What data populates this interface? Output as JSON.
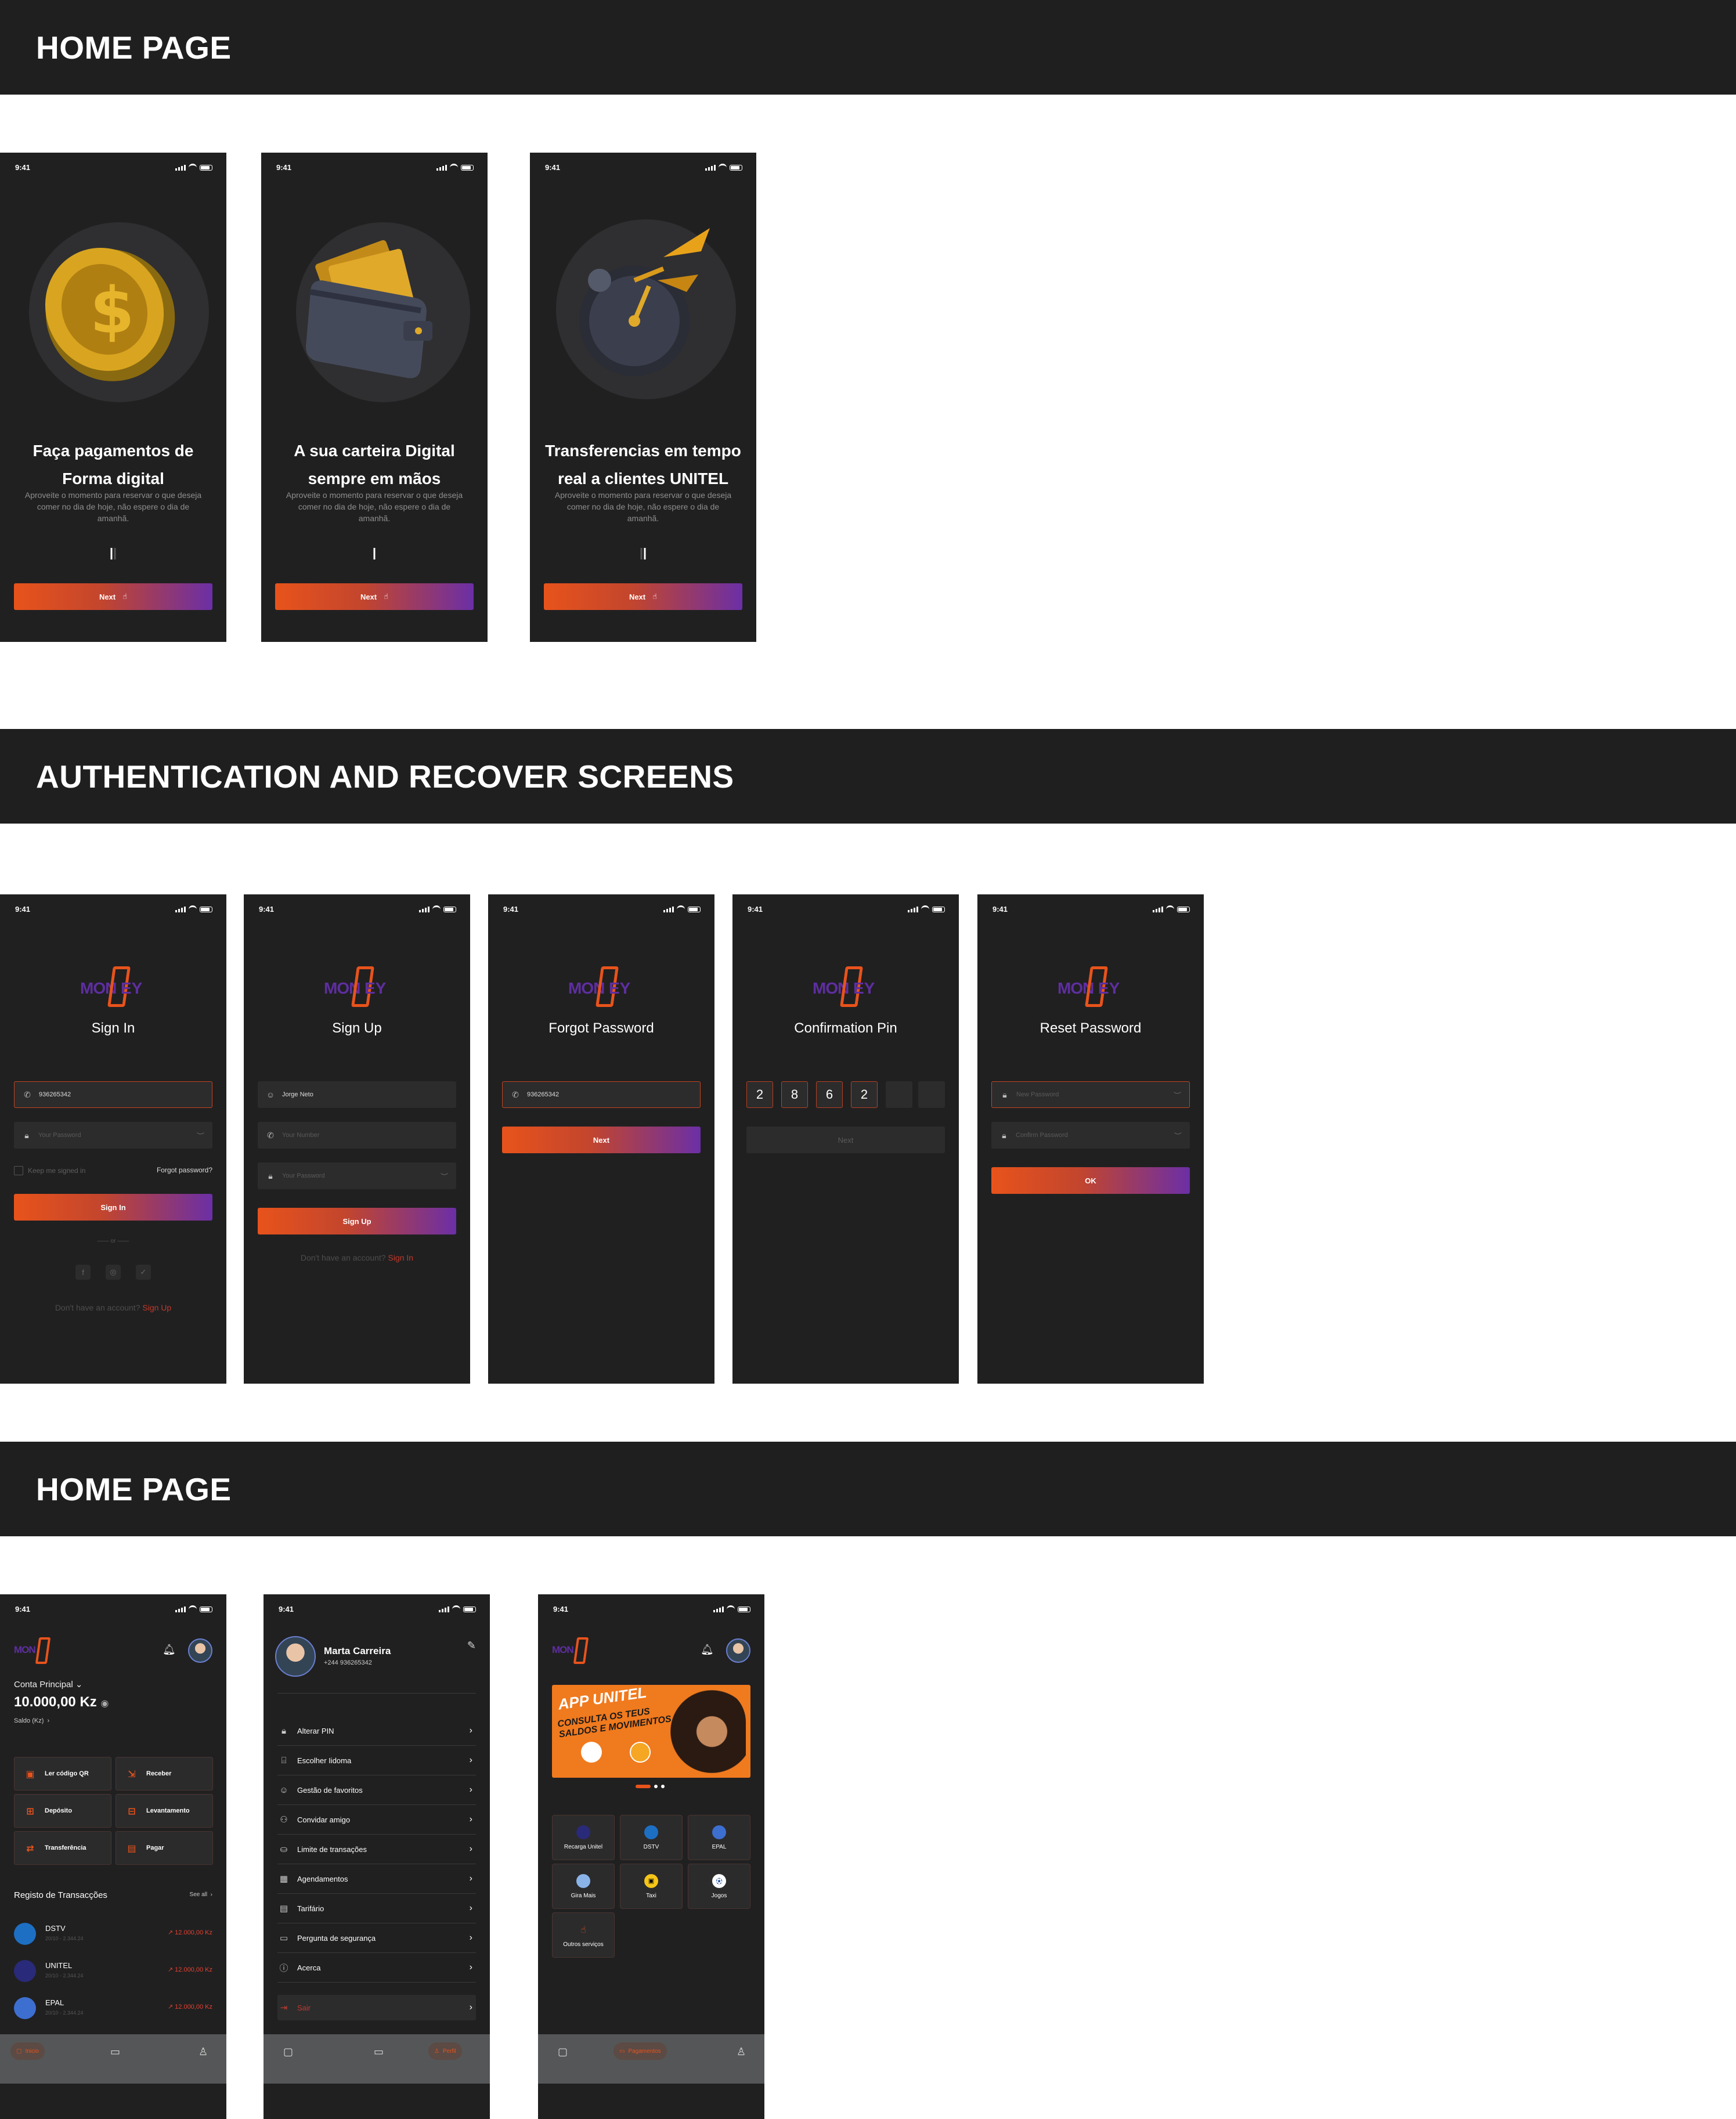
{
  "status": {
    "time": "9:41"
  },
  "sections": {
    "home1": "HOME PAGE",
    "auth": "AUTHENTICATION AND RECOVER SCREENS",
    "home2": "HOME PAGE"
  },
  "onboarding": [
    {
      "title_line1": "Faça pagamentos de",
      "title_line2": "Forma digital",
      "desc": "Aproveite o momento para reservar o que deseja comer no dia de hoje, não espere o dia de amanhã.",
      "button": "Next"
    },
    {
      "title_line1": "A sua carteira Digital",
      "title_line2": "sempre em mãos",
      "desc": "Aproveite o momento para reservar o que deseja comer no dia de hoje, não espere o dia de amanhã.",
      "button": "Next"
    },
    {
      "title_line1": "Transferencias em tempo",
      "title_line2": "real  a clientes UNITEL",
      "desc": "Aproveite o momento para reservar o que deseja comer no dia de hoje, não espere o dia de amanhã.",
      "button": "Next"
    }
  ],
  "logo": {
    "left": "MON",
    "right": "EY"
  },
  "signin": {
    "title": "Sign In",
    "phone_value": "936265342",
    "password_placeholder": "Your Password",
    "keep_signed": "Keep me signed in",
    "forgot": "Forgot password?",
    "button": "Sign In",
    "or": "or",
    "no_account": "Don't have an account?",
    "signup_link": "Sign Up"
  },
  "signup": {
    "title": "Sign Up",
    "name_value": "Jorge Neto",
    "number_placeholder": "Your Number",
    "password_placeholder": "Your Password",
    "button": "Sign Up",
    "have_account": "Don't have an account?",
    "signin_link": "Sign In"
  },
  "forgot": {
    "title": "Forgot Password",
    "phone_value": "936265342",
    "button": "Next"
  },
  "pin": {
    "title": "Confirmation Pin",
    "digits": [
      "2",
      "8",
      "6",
      "2",
      "",
      ""
    ],
    "button": "Next"
  },
  "reset": {
    "title": "Reset Password",
    "new_placeholder": "New Password",
    "confirm_placeholder": "Confirm Password",
    "button": "OK"
  },
  "dashboard": {
    "account_label": "Conta Principal",
    "balance": "10.000,00 Kz",
    "saldo": "Saldo (Kz)",
    "actions": [
      "Ler código QR",
      "Receber",
      "Depósito",
      "Levantamento",
      "Transferência",
      "Pagar"
    ],
    "tx_title": "Registo de Transacções",
    "see_all": "See all",
    "transactions": [
      {
        "name": "DSTV",
        "date": "20/10 - 2.344.24",
        "amount": "12.000,00 Kz",
        "color": "#1d6fc4"
      },
      {
        "name": "UNITEL",
        "date": "20/10 - 2.344.24",
        "amount": "12.000,00 Kz",
        "color": "#2a2a7a"
      },
      {
        "name": "EPAL",
        "date": "20/10 - 2.344.24",
        "amount": "12.000,00 Kz",
        "color": "#3d6fd0"
      }
    ],
    "nav": {
      "home": "Inicio"
    }
  },
  "profile": {
    "name": "Marta Carreira",
    "phone": "+244 936265342",
    "items": [
      "Alterar PIN",
      "Escolher Iidoma",
      "Gestão de favoritos",
      "Convidar amigo",
      "Limite de transações",
      "Agendamentos",
      "Tarifário",
      "Pergunta de segurança",
      "Acerca"
    ],
    "logout": "Sair",
    "nav_active": "Perfil"
  },
  "payments": {
    "banner_title": "APP UNITEL",
    "banner_sub1": "CONSULTA OS TEUS",
    "banner_sub2": "SALDOS E MOVIMENTOS",
    "services": [
      "Recarga Unitel",
      "DSTV",
      "EPAL",
      "Gira Mais",
      "Taxi",
      "Jogos",
      "Outros serviços"
    ],
    "nav_active": "Pagamentos"
  },
  "colors": {
    "accent": "#e8531b",
    "purple": "#6b2fa6",
    "bg": "#202021",
    "band": "#1f1f20"
  }
}
